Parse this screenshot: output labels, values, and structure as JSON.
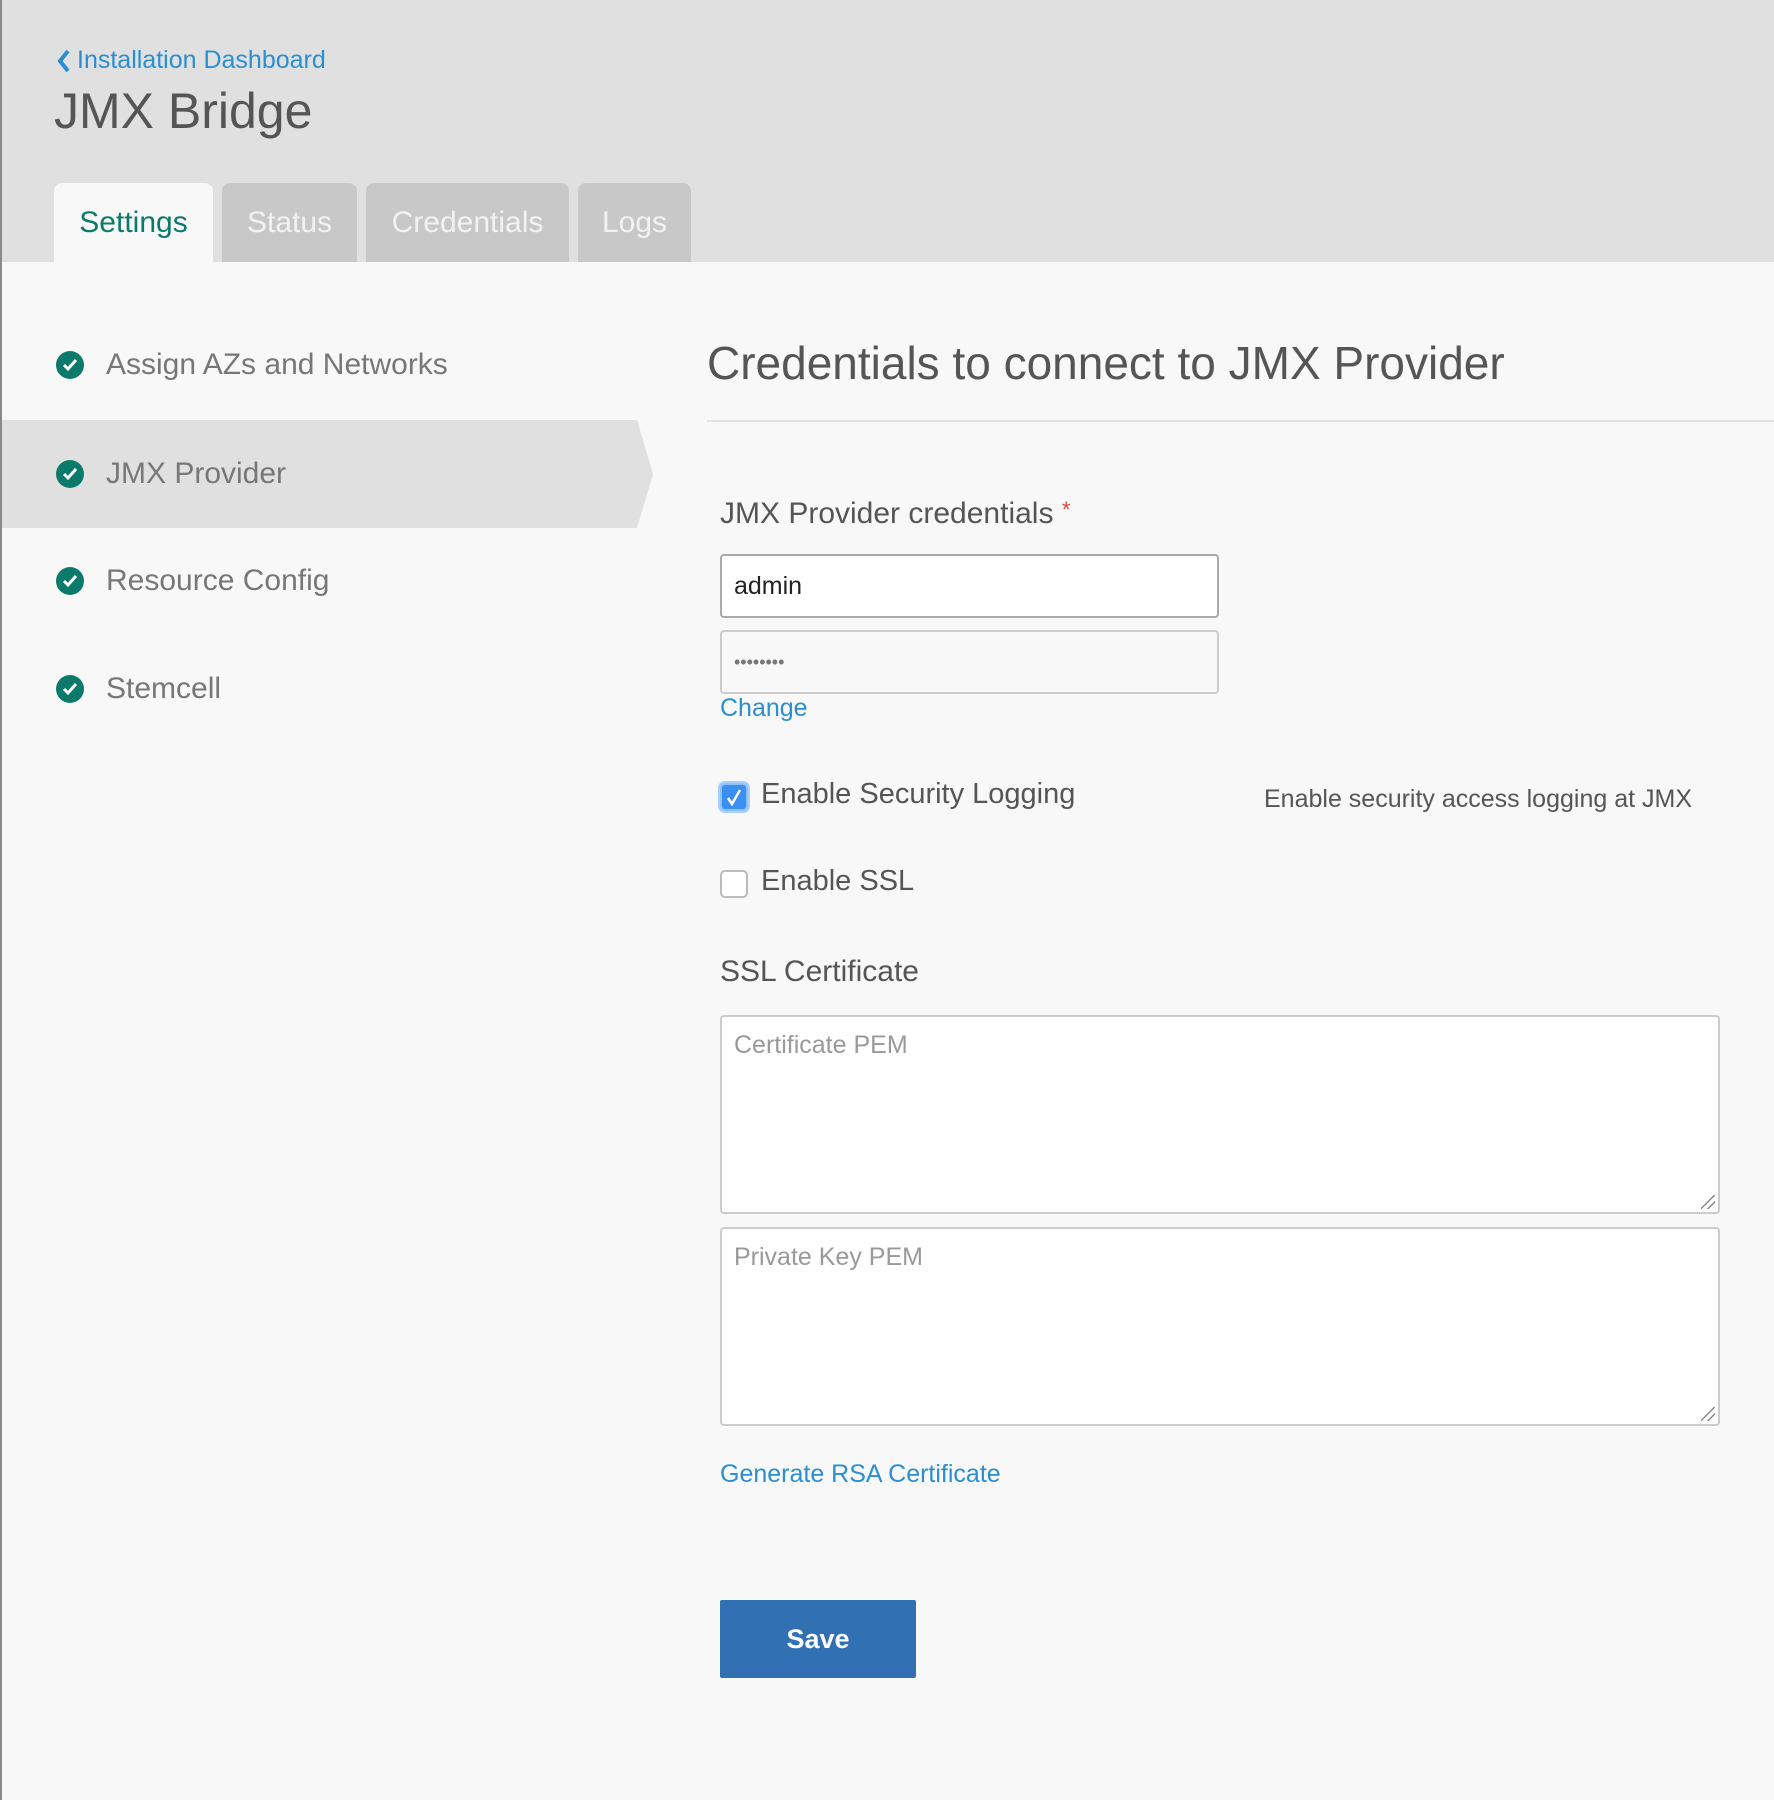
{
  "header": {
    "back_label": "Installation Dashboard",
    "title": "JMX Bridge"
  },
  "tabs": [
    {
      "label": "Settings",
      "active": true
    },
    {
      "label": "Status"
    },
    {
      "label": "Credentials"
    },
    {
      "label": "Logs"
    }
  ],
  "sidebar": {
    "items": [
      {
        "label": "Assign AZs and Networks",
        "status": "complete"
      },
      {
        "label": "JMX Provider",
        "status": "complete",
        "active": true
      },
      {
        "label": "Resource Config",
        "status": "complete"
      },
      {
        "label": "Stemcell",
        "status": "complete"
      }
    ]
  },
  "form": {
    "heading": "Credentials to connect to JMX Provider",
    "credentials_label": "JMX Provider credentials",
    "required_mark": "*",
    "username_value": "admin",
    "password_value": "••••••••",
    "change_label": "Change",
    "security_logging": {
      "label": "Enable Security Logging",
      "checked": true,
      "description": "Enable security access logging at JMX"
    },
    "ssl": {
      "label": "Enable SSL",
      "checked": false
    },
    "ssl_cert_label": "SSL Certificate",
    "cert_placeholder": "Certificate PEM",
    "key_placeholder": "Private Key PEM",
    "generate_label": "Generate RSA Certificate",
    "save_label": "Save"
  },
  "colors": {
    "accent": "#0c7a6a",
    "link": "#2a8fd0",
    "button": "#3270b4"
  }
}
